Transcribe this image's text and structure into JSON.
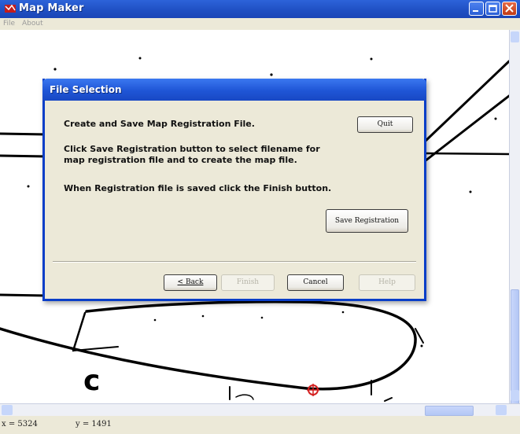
{
  "window": {
    "title": "Map Maker",
    "menu": [
      "File",
      "About"
    ],
    "controls": [
      "minimize-icon",
      "maximize-icon",
      "close-icon"
    ]
  },
  "map": {
    "label": "c"
  },
  "dialog": {
    "title": "File Selection",
    "heading": "Create and Save Map Registration File.",
    "instruction_line1": "Click Save Registration button to select filename for",
    "instruction_line2": "map registration file and to create the map file.",
    "finish_note": "When Registration file is saved click the Finish button.",
    "quit_label": "Quit",
    "save_registration_label": "Save Registration",
    "back_label": "< Back",
    "finish_label": "Finish",
    "cancel_label": "Cancel",
    "help_label": "Help"
  },
  "status": {
    "x": "x = 5324",
    "y": "y = 1491"
  },
  "colors": {
    "titlebar": "#1f4fc2",
    "dialog_border": "#0a3ec8",
    "dialog_bg": "#ece9d8",
    "marker": "#d42020"
  }
}
